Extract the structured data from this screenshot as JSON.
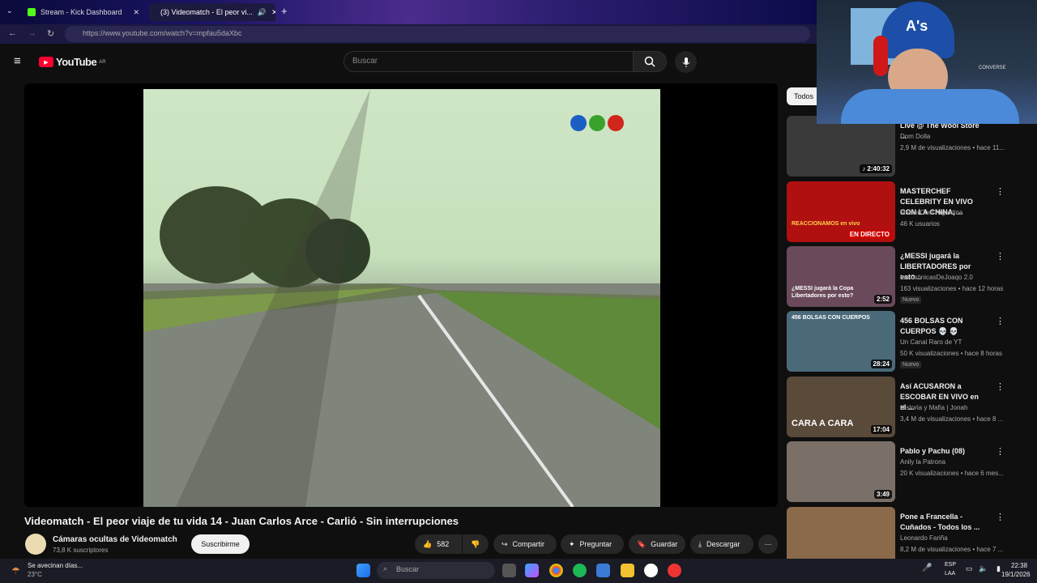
{
  "browser": {
    "tabs": [
      {
        "label": "Stream - Kick Dashboard",
        "color": "#53fc18"
      },
      {
        "label": "(3) Videomatch - El peor vi...",
        "color": "#ff0033"
      }
    ],
    "url": "https://www.youtube.com/watch?v=mpfau5daXbc"
  },
  "header": {
    "logo": "YouTube",
    "region": "AR",
    "search_placeholder": "Buscar"
  },
  "video": {
    "title": "Videomatch - El peor viaje de tu vida 14 - Juan Carlos Arce - Carlió - Sin interrupciones",
    "channel": "Cámaras ocultas de Videomatch",
    "subscribers": "73,8 K suscriptores",
    "subscribe_label": "Suscribirme",
    "likes": "582",
    "share_label": "Compartir",
    "ask_label": "Preguntar",
    "save_label": "Guardar",
    "download_label": "Descargar"
  },
  "sidebar": {
    "chip": "Todos",
    "items": [
      {
        "title": "Live @ The Wool Store ...",
        "channel": "Dom Dolla",
        "meta": "2,9 M de visualizaciones • hace 11...",
        "duration": "♪ 2:40:32",
        "thumb": "#3a3a3a"
      },
      {
        "title": "MASTERCHEF CELEBRITY EN VIVO CON LA CHINA, ...",
        "channel": "MasterChef Argentina",
        "meta": "46 K usuarios",
        "duration": "EN DIRECTO",
        "thumb": "#b01010"
      },
      {
        "title": "¿MESSI jugará la LIBERTADORES por esto...",
        "channel": "LasCrónicasDeJoaqo 2.0",
        "meta": "163 visualizaciones • hace 12 horas",
        "badge": "Nuevo",
        "duration": "2:52",
        "thumb": "#6a4a5a"
      },
      {
        "title": "456 BOLSAS CON CUERPOS 💀 💀",
        "channel": "Un Canal Raro de YT",
        "meta": "50 K visualizaciones • hace 8 horas",
        "badge": "Nuevo",
        "duration": "28:24",
        "thumb": "#4a6a7a"
      },
      {
        "title": "Así ACUSARON a ESCOBAR EN VIVO en el ...",
        "channel": "Historia y Mafia | Jonah",
        "meta": "3,4 M de visualizaciones • hace 8 ...",
        "duration": "17:04",
        "thumb": "#5a4a3a"
      },
      {
        "title": "Pablo y Pachu (08)",
        "channel": "Anily la Patrona",
        "meta": "20 K visualizaciones • hace 6 mes...",
        "duration": "3:49",
        "thumb": "#7a7068"
      },
      {
        "title": "Pone a Francella - Cuñados - Todos los ...",
        "channel": "Leonardo Fariña",
        "meta": "8,2 M de visualizaciones • hace 7 ...",
        "duration": "",
        "thumb": "#8a6a4a"
      }
    ]
  },
  "thumb_texts": {
    "masterchef": "REACCIONAMOS en vivo",
    "messi": "¿MESSI jugará la Copa Libertadores por esto?",
    "bolsas": "456 BOLSAS CON CUERPOS",
    "escobar": "CARA A CARA"
  },
  "taskbar": {
    "weather_text": "Se avecinan días...",
    "temperature": "23°C",
    "search_placeholder": "Buscar",
    "lang": "ESP",
    "lang2": "LAA",
    "time": "22:38",
    "date": "19/1/2026"
  },
  "webcam": {
    "cap_logo": "A's",
    "sign": "CONVERSE"
  }
}
